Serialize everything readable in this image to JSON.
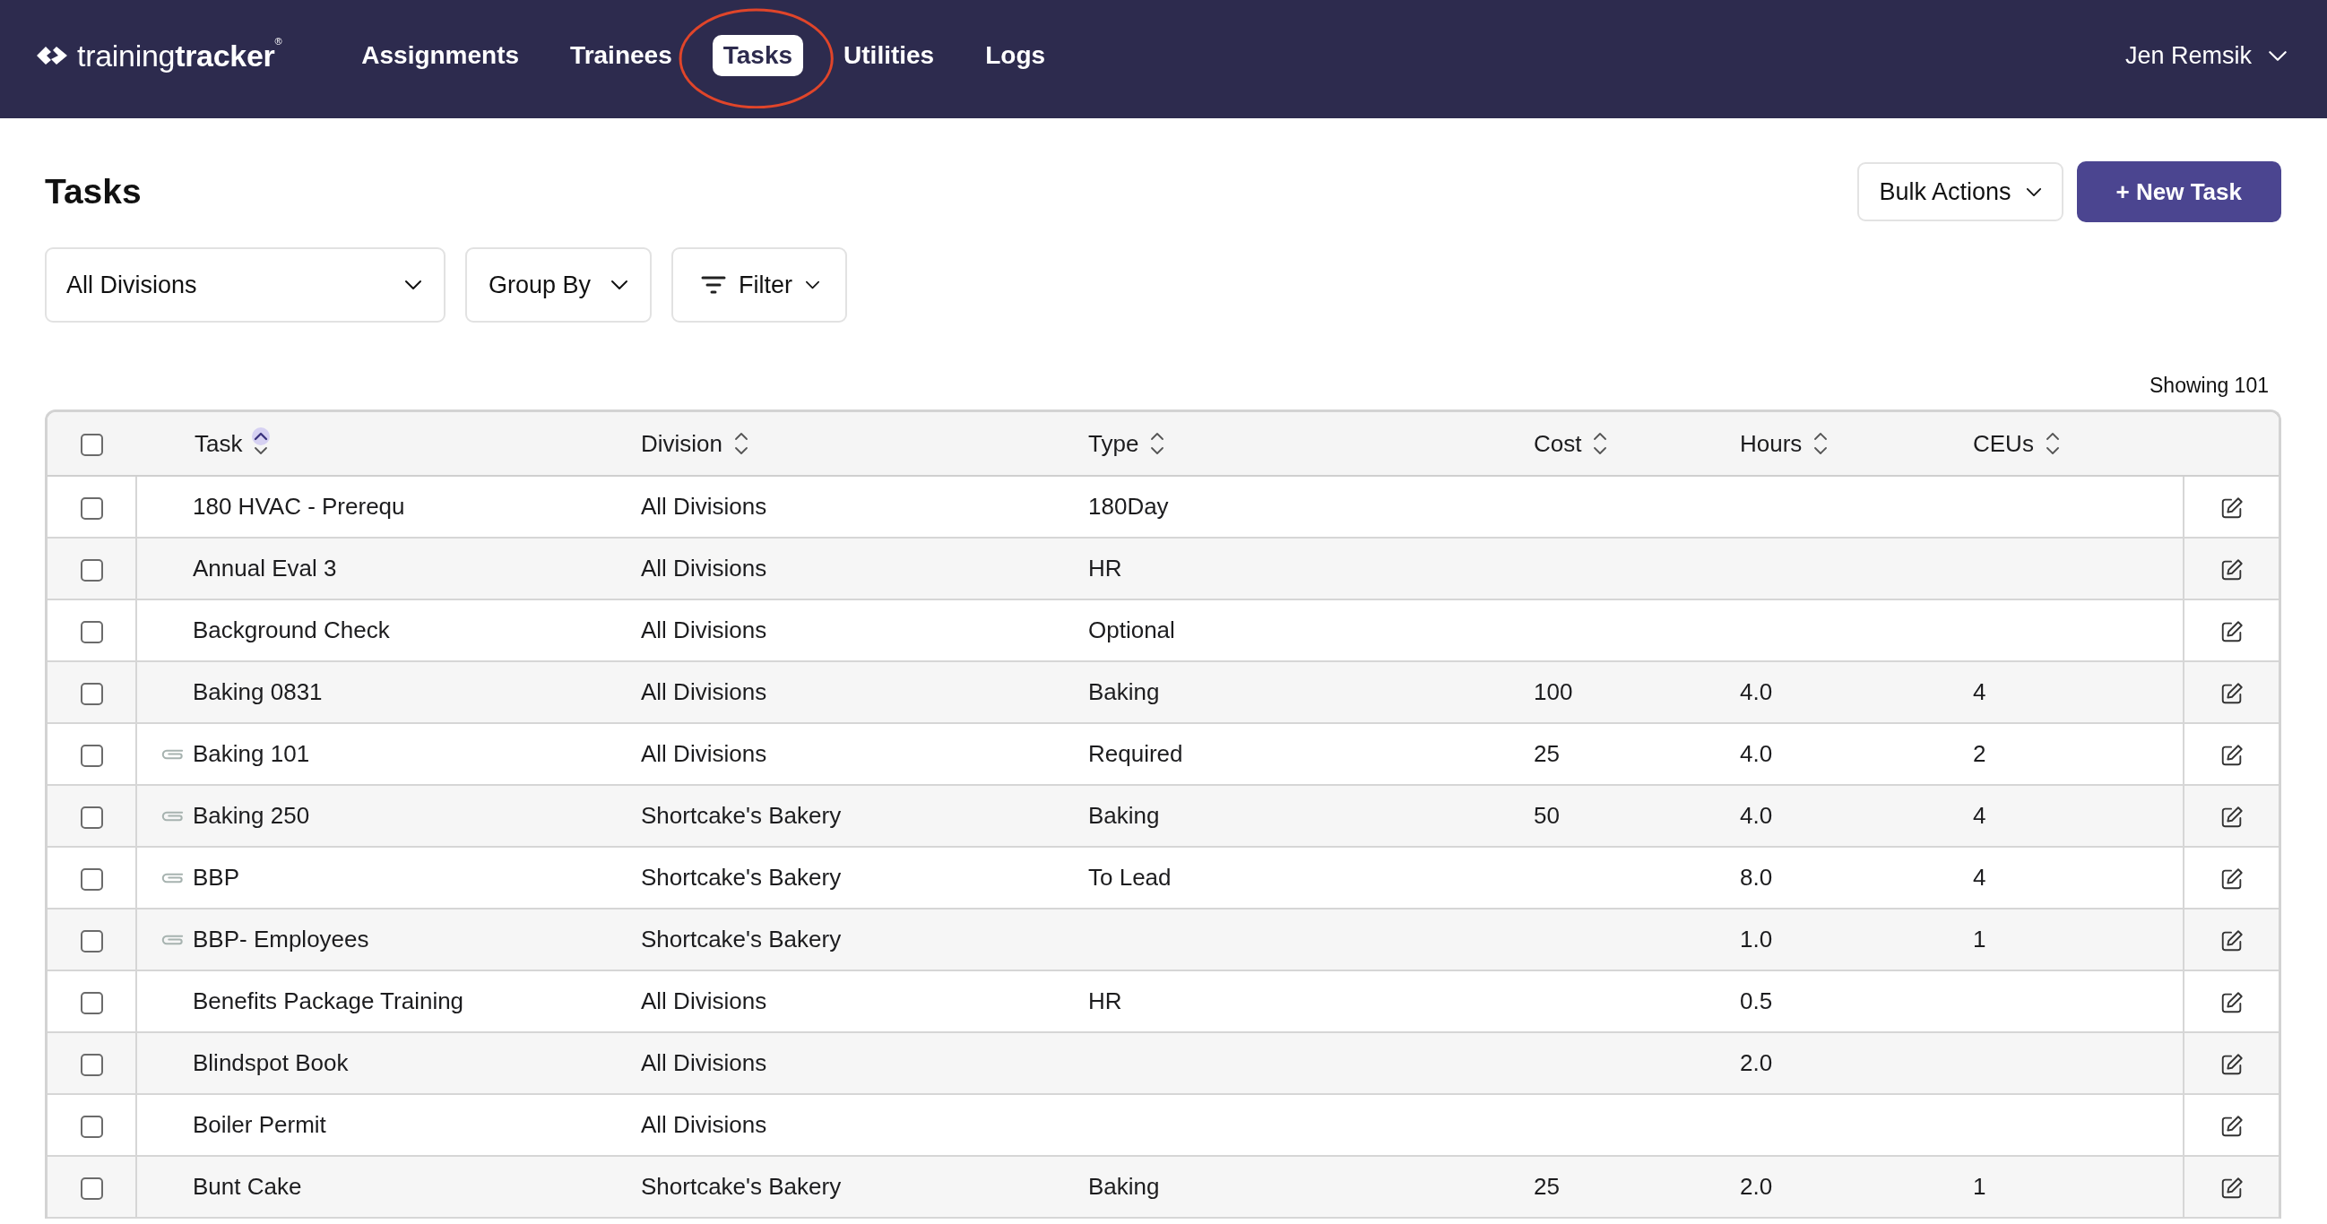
{
  "header": {
    "logo": "training**tracker**$^{®}$",
    "user": "Jen Remsik"
  },
  "nav": [
    {
      "label": "Assignments",
      "selected": false,
      "circled": false
    },
    {
      "label": "Trainees",
      "selected": false,
      "circled": false
    },
    {
      "label": "Tasks",
      "selected": true,
      "circled": true
    },
    {
      "label": "Utilities",
      "selected": false,
      "circled": false
    },
    {
      "label": "Logs",
      "selected": false,
      "circled": false
    }
  ],
  "page": {
    "title": "Tasks",
    "actions": [
      {
        "kind": "menu",
        "label": "Bulk Actions"
      },
      {
        "kind": "primary",
        "label": "+ New Task"
      }
    ]
  },
  "filters": [
    {
      "kind": "select",
      "label": "All Divisions"
    },
    {
      "kind": "menu",
      "label": "Group By"
    },
    {
      "kind": "filter",
      "label": "Filter"
    }
  ],
  "table": {
    "count": "Showing 101",
    "select_all": {
      "checked": false
    },
    "columns": [
      {
        "label": "Task",
        "sorted": true
      },
      {
        "label": "Division",
        "sorted": false
      },
      {
        "label": "Type",
        "sorted": false
      },
      {
        "label": "Cost",
        "sorted": false
      },
      {
        "label": "Hours",
        "sorted": false
      },
      {
        "label": "CEUs",
        "sorted": false
      }
    ],
    "rows": [
      {
        "checked": false,
        "attachment": false,
        "task": "180 HVAC - Prerequ",
        "division": "All Divisions",
        "type": "180Day"
      },
      {
        "checked": false,
        "attachment": false,
        "task": "Annual Eval 3",
        "division": "All Divisions",
        "type": "HR"
      },
      {
        "checked": false,
        "attachment": false,
        "task": "Background Check",
        "division": "All Divisions",
        "type": "Optional"
      },
      {
        "checked": false,
        "attachment": false,
        "task": "Baking 0831",
        "division": "All Divisions",
        "type": "Baking",
        "cost": "100",
        "hours": "4.0",
        "ceus": "4"
      },
      {
        "checked": false,
        "attachment": true,
        "task": "Baking 101",
        "division": "All Divisions",
        "type": "Required",
        "cost": "25",
        "hours": "4.0",
        "ceus": "2"
      },
      {
        "checked": false,
        "attachment": true,
        "task": "Baking 250",
        "division": "Shortcake's Bakery",
        "type": "Baking",
        "cost": "50",
        "hours": "4.0",
        "ceus": "4"
      },
      {
        "checked": false,
        "attachment": true,
        "task": "BBP",
        "division": "Shortcake's Bakery",
        "type": "To Lead",
        "hours": "8.0",
        "ceus": "4"
      },
      {
        "checked": false,
        "attachment": true,
        "task": "BBP- Employees",
        "division": "Shortcake's Bakery",
        "hours": "1.0",
        "ceus": "1"
      },
      {
        "checked": false,
        "attachment": false,
        "task": "Benefits Package Training",
        "division": "All Divisions",
        "type": "HR",
        "hours": "0.5"
      },
      {
        "checked": false,
        "attachment": false,
        "task": "Blindspot Book",
        "division": "All Divisions",
        "hours": "2.0"
      },
      {
        "checked": false,
        "attachment": false,
        "task": "Boiler Permit",
        "division": "All Divisions"
      },
      {
        "checked": false,
        "attachment": false,
        "task": "Bunt Cake",
        "division": "Shortcake's Bakery",
        "type": "Baking",
        "cost": "25",
        "hours": "2.0",
        "ceus": "1"
      }
    ]
  }
}
